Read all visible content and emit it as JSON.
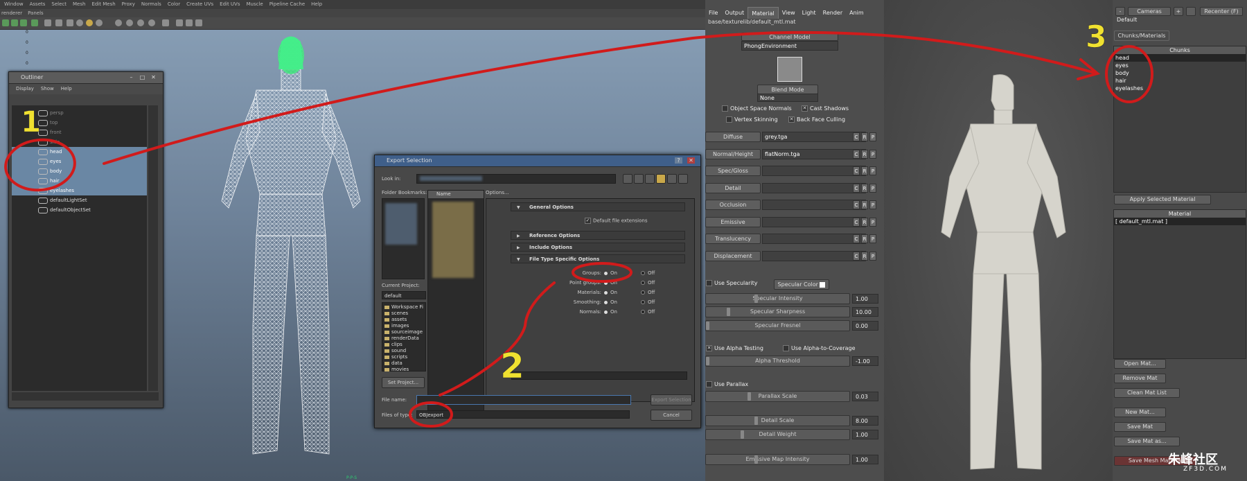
{
  "maya": {
    "menus": [
      "Window",
      "Assets",
      "Select",
      "Mesh",
      "Edit Mesh",
      "Proxy",
      "Normals",
      "Color",
      "Create UVs",
      "Edit UVs",
      "Muscle",
      "Pipeline Cache",
      "Help"
    ],
    "panel_menus": [
      "renderer",
      "Panels"
    ],
    "grid_numbers": [
      "0",
      "0",
      "0",
      "0",
      "0"
    ],
    "status_text": "P-P-S"
  },
  "outliner": {
    "title": "Outliner",
    "menus": [
      "Display",
      "Show",
      "Help"
    ],
    "items": [
      {
        "label": "persp",
        "state": "dim"
      },
      {
        "label": "top",
        "state": "dim"
      },
      {
        "label": "front",
        "state": "dim"
      },
      {
        "label": "side",
        "state": "dim"
      },
      {
        "label": "head",
        "state": "selected"
      },
      {
        "label": "eyes",
        "state": "selected"
      },
      {
        "label": "body",
        "state": "selected"
      },
      {
        "label": "hair",
        "state": "selected"
      },
      {
        "label": "eyelashes",
        "state": "selected"
      },
      {
        "label": "defaultLightSet",
        "state": "normal"
      },
      {
        "label": "defaultObjectSet",
        "state": "normal"
      }
    ]
  },
  "export_dialog": {
    "title": "Export Selection",
    "look_in_label": "Look in:",
    "bookmarks_label": "Folder Bookmarks:",
    "name_column": "Name",
    "options_label": "Options...",
    "current_project_label": "Current Project:",
    "current_project": "default",
    "project_folders": [
      "Workspace Fi",
      "scenes",
      "assets",
      "images",
      "sourceimage",
      "renderData",
      "clips",
      "sound",
      "scripts",
      "data",
      "movies"
    ],
    "set_project_button": "Set Project...",
    "file_name_label": "File name:",
    "files_of_type_label": "Files of type:",
    "files_of_type": "OBJexport",
    "export_button": "Export Selection",
    "cancel_button": "Cancel",
    "sections": {
      "general": "General Options",
      "default_ext": "Default file extensions",
      "reference": "Reference Options",
      "include": "Include Options",
      "file_type": "File Type Specific Options"
    },
    "obj_options": [
      {
        "label": "Groups:",
        "on": "On",
        "off": "Off",
        "value": "On"
      },
      {
        "label": "Point groups:",
        "on": "On",
        "off": "Off",
        "value": "On"
      },
      {
        "label": "Materials:",
        "on": "On",
        "off": "Off",
        "value": "On"
      },
      {
        "label": "Smoothing:",
        "on": "On",
        "off": "Off",
        "value": "On"
      },
      {
        "label": "Normals:",
        "on": "On",
        "off": "Off",
        "value": "On"
      }
    ]
  },
  "editor": {
    "tabs": [
      "File",
      "Output",
      "Material",
      "View",
      "Light",
      "Render",
      "Anim"
    ],
    "active_tab": "Material",
    "path": "base/texturelib/default_mtl.mat",
    "channel_model_button": "Channel Model",
    "channel_model_value": "PhongEnvironment",
    "blend_mode_button": "Blend Mode",
    "blend_mode_value": "None",
    "checks": {
      "object_space_normals": "Object Space Normals",
      "cast_shadows": "Cast Shadows",
      "vertex_skinning": "Vertex Skinning",
      "back_face_culling": "Back Face Culling"
    },
    "maps": [
      {
        "label": "Diffuse",
        "file": "grey.tga"
      },
      {
        "label": "Normal/Height",
        "file": "flatNorm.tga"
      },
      {
        "label": "Spec/Gloss",
        "file": ""
      },
      {
        "label": "Detail",
        "file": ""
      },
      {
        "label": "Occlusion",
        "file": ""
      },
      {
        "label": "Emissive",
        "file": ""
      },
      {
        "label": "Translucency",
        "file": ""
      },
      {
        "label": "Displacement",
        "file": ""
      }
    ],
    "crp": [
      "C",
      "R",
      "P"
    ],
    "use_specularity": "Use Specularity",
    "specular_color": "Specular Color",
    "use_alpha_testing": "Use Alpha Testing",
    "use_alpha_to_coverage": "Use Alpha-to-Coverage",
    "use_parallax": "Use Parallax",
    "sliders": [
      {
        "label": "Specular Intensity",
        "value": "1.00",
        "level": 0.35
      },
      {
        "label": "Specular Sharpness",
        "value": "10.00",
        "level": 0.15
      },
      {
        "label": "Specular Fresnel",
        "value": "0.00",
        "level": 0.0
      },
      {
        "label": "Alpha Threshold",
        "value": "-1.00",
        "level": 0.0
      },
      {
        "label": "Parallax Scale",
        "value": "0.03",
        "level": 0.3
      },
      {
        "label": "Detail Scale",
        "value": "8.00",
        "level": 0.35
      },
      {
        "label": "Detail Weight",
        "value": "1.00",
        "level": 0.25
      },
      {
        "label": "Emissive Map Intensity",
        "value": "1.00",
        "level": 0.35
      }
    ],
    "viewport_top": [
      "-",
      "Cameras",
      "+",
      "Recenter (F)"
    ],
    "default_label": "Default",
    "chunks_tab": "Chunks/Materials",
    "chunks_header": "Chunks",
    "chunks": [
      "head",
      "eyes",
      "body",
      "hair",
      "eyelashes"
    ],
    "apply_material_button": "Apply Selected Material",
    "material_header": "Material",
    "materials": [
      "[ default_mtl.mat ]"
    ],
    "buttons": [
      "Open Mat...",
      "Remove Mat",
      "Clean Mat List",
      "New Mat...",
      "Save Mat",
      "Save Mat as...",
      "Save Mesh Material"
    ],
    "watermark": "朱峰社区",
    "watermark_sub": "ZF3D.COM"
  },
  "annotations": [
    "1",
    "2",
    "3"
  ]
}
